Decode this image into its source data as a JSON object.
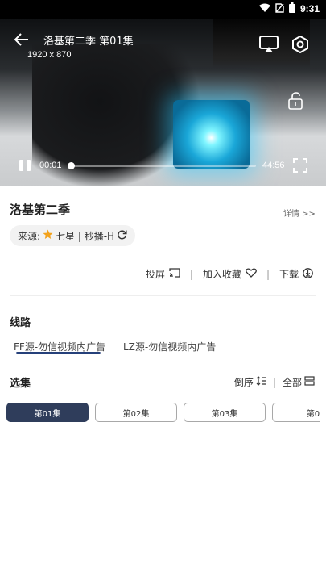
{
  "status_bar": {
    "time": "9:31"
  },
  "player": {
    "title": "洛基第二季 第01集",
    "resolution": "1920 x 870",
    "current_time": "00:01",
    "total_time": "44:56",
    "progress": 0.0004
  },
  "info": {
    "show_title": "洛基第二季",
    "details_link": "详情 >>",
    "source_prefix": "来源:",
    "source_name": "七星 | 秒播-H",
    "actions": {
      "cast": "投屏",
      "favorite": "加入收藏",
      "download": "下载"
    }
  },
  "routes": {
    "section_title": "线路",
    "items": [
      "FF源-勿信视频内广告",
      "LZ源-勿信视频内广告"
    ],
    "selected_index": 0
  },
  "episodes": {
    "section_title": "选集",
    "sort_label": "倒序",
    "all_label": "全部",
    "items": [
      "第01集",
      "第02集",
      "第03集",
      "第0"
    ],
    "selected_index": 0
  }
}
